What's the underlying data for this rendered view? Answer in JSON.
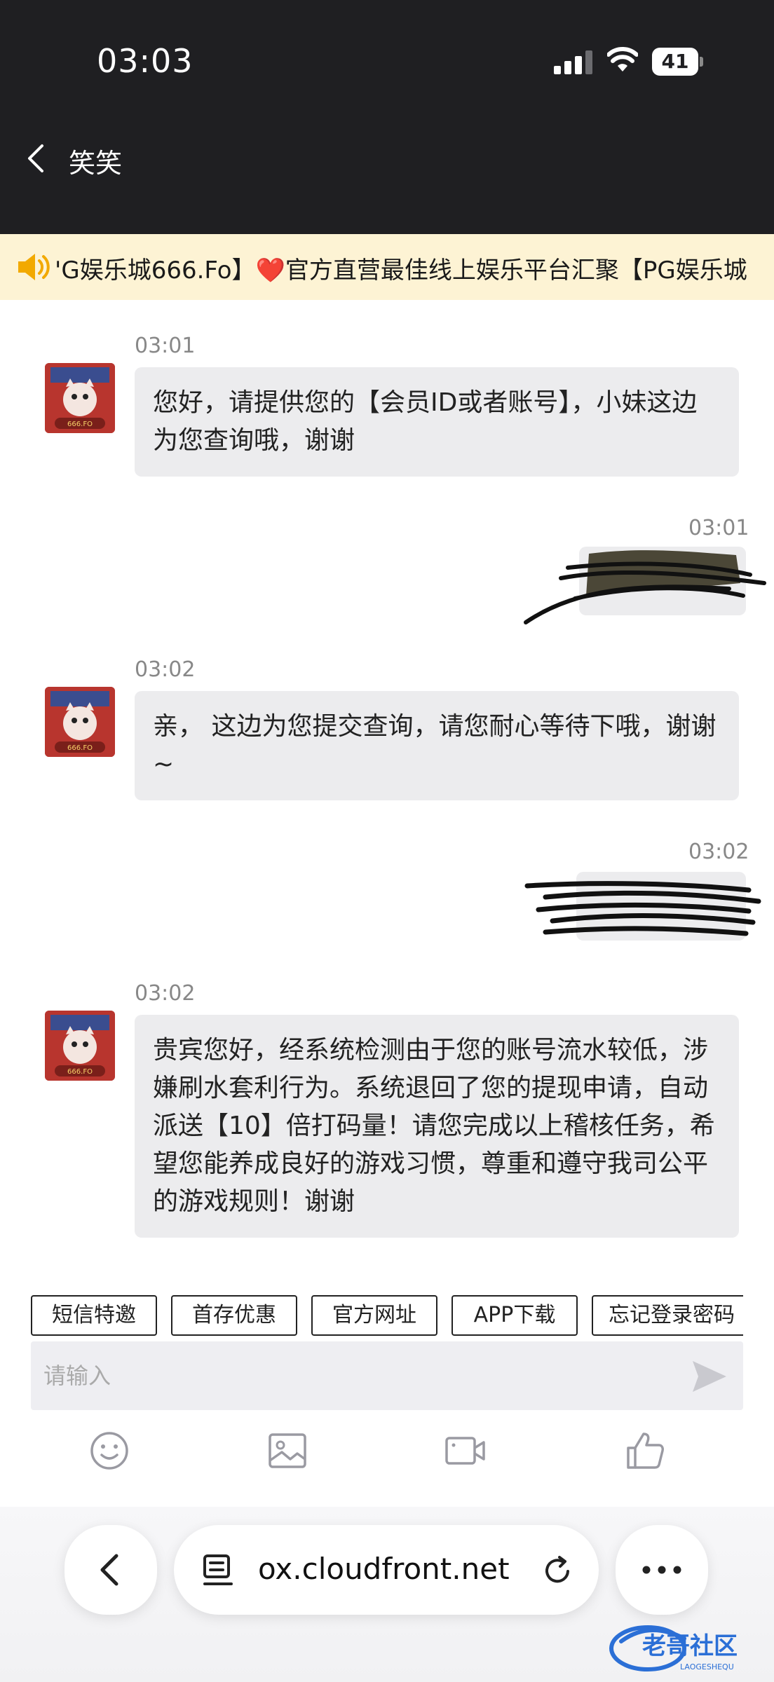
{
  "status_bar": {
    "time": "03:03",
    "battery": "41"
  },
  "header": {
    "contact_name": "笑笑"
  },
  "announcement": {
    "text_before": "'G娱乐城666.Fo】",
    "heart": "❤️",
    "text_after": "官方直营最佳线上娱乐平台汇聚【PG娱乐城"
  },
  "messages": [
    {
      "side": "in",
      "time": "03:01",
      "text": "您好，请提供您的【会员ID或者账号】，小妹这边为您查询哦，谢谢"
    },
    {
      "side": "out",
      "time": "03:01"
    },
    {
      "side": "in",
      "time": "03:02",
      "text": "亲， 这边为您提交查询，请您耐心等待下哦，谢谢~"
    },
    {
      "side": "out",
      "time": "03:02"
    },
    {
      "side": "in",
      "time": "03:02",
      "text": "贵宾您好，经系统检测由于您的账号流水较低，涉嫌刷水套利行为。系统退回了您的提现申请，自动派送【10】倍打码量！请您完成以上稽核任务，希望您能养成良好的游戏习惯，尊重和遵守我司公平的游戏规则！谢谢"
    }
  ],
  "avatar_caption": "666.FO",
  "quick_replies": [
    "短信特邀",
    "首存优惠",
    "官方网址",
    "APP下载",
    "忘记登录密码"
  ],
  "composer": {
    "placeholder": "请输入"
  },
  "toolbar_icons": [
    "emoji-icon",
    "image-icon",
    "video-icon",
    "thumbs-up-icon"
  ],
  "browser": {
    "url": "ox.cloudfront.net"
  },
  "watermark": {
    "title": "老哥社区",
    "subtitle": "LAOGESHEQU"
  },
  "colors": {
    "header_bg": "#1f1f22",
    "banner_bg": "#fdf3d4",
    "bubble_bg": "#ececee",
    "heart": "#e0242c",
    "watermark_blue": "#2b6fd6"
  }
}
